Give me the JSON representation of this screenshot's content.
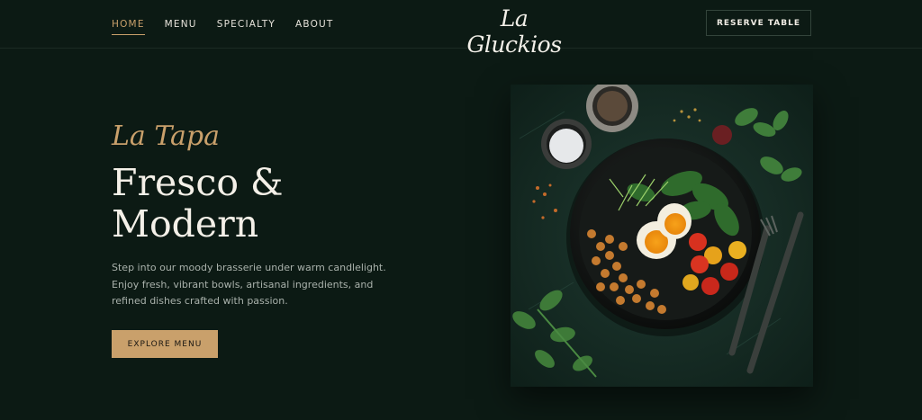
{
  "nav": {
    "items": [
      {
        "label": "HOME",
        "active": true
      },
      {
        "label": "MENU",
        "active": false
      },
      {
        "label": "SPECIALTY",
        "active": false
      },
      {
        "label": "ABOUT",
        "active": false
      }
    ]
  },
  "brand": {
    "logo_text": "La Gluckios"
  },
  "header": {
    "reserve_label": "RESERVE TABLE"
  },
  "hero": {
    "eyebrow": "La Tapa",
    "title_line1": "Fresco &",
    "title_line2": "Modern",
    "description": "Step into our moody brasserie under warm candlelight. Enjoy fresh, vibrant bowls, artisanal ingredients, and refined dishes crafted with passion.",
    "cta_label": "EXPLORE MENU",
    "image_icon": "food-bowl-photo"
  },
  "colors": {
    "background": "#0c1a14",
    "accent": "#c9a06b",
    "text": "#f4f0e8",
    "muted": "#a9b1ab"
  }
}
